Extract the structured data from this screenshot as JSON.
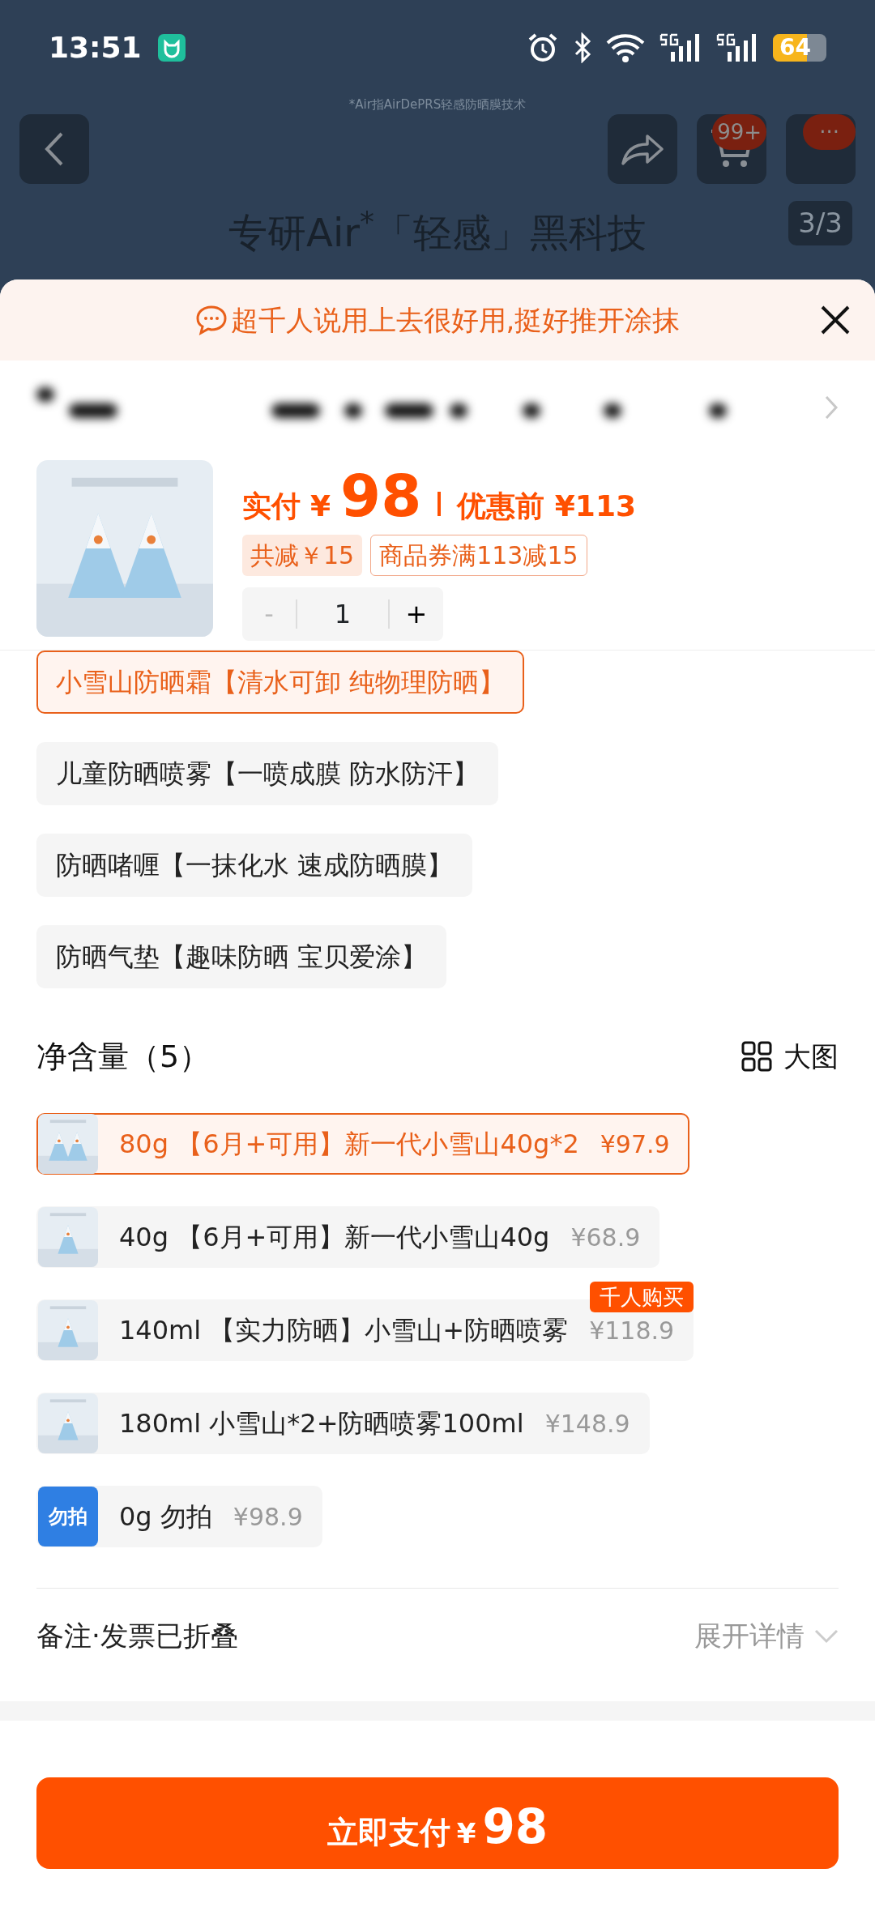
{
  "status_bar": {
    "time": "13:51",
    "battery": "64"
  },
  "backdrop": {
    "caption": "*Air指AirDePRS轻感防晒膜技术",
    "cart_badge": "99+",
    "more_badge": "···",
    "headline": "专研Air$^{*}$「轻感」黑科技",
    "page_indicator": "3/3"
  },
  "tip": {
    "text": "超千人说用上去很好用,挺好推开涂抹"
  },
  "product": {
    "price_label": "实付",
    "currency": "¥",
    "price": "98",
    "original_price": "优惠前 ¥113",
    "discount": "共减￥15",
    "coupon": "商品券满113减15",
    "minus": "-",
    "quantity": "1",
    "plus": "+"
  },
  "styles": [
    {
      "label": "小雪山防晒霜【清水可卸 纯物理防晒】",
      "selected": true
    },
    {
      "label": "儿童防晒喷雾【一喷成膜 防水防汗】",
      "selected": false
    },
    {
      "label": "防晒啫喱【一抹化水 速成防晒膜】",
      "selected": false
    },
    {
      "label": "防晒气垫【趣味防晒 宝贝爱涂】",
      "selected": false
    }
  ],
  "size_section": {
    "title": "净含量（5）",
    "view_toggle": "大图",
    "options": [
      {
        "kind": "thumb",
        "label": "80g 【6月+可用】新一代小雪山40g*2",
        "price": "¥97.9",
        "selected": true
      },
      {
        "kind": "thumb",
        "label": "40g 【6月+可用】新一代小雪山40g",
        "price": "¥68.9",
        "selected": false
      },
      {
        "kind": "thumb",
        "label": "140ml 【实力防晒】小雪山+防晒喷雾",
        "price": "¥118.9",
        "selected": false,
        "tag": "千人购买"
      },
      {
        "kind": "thumb",
        "label": "180ml 小雪山*2+防晒喷雾100ml",
        "price": "¥148.9",
        "selected": false
      },
      {
        "kind": "text-badge",
        "badge": "勿拍",
        "label": "0g 勿拍",
        "price": "¥98.9",
        "selected": false
      }
    ]
  },
  "note_row": {
    "label": "备注·发票已折叠",
    "action": "展开详情"
  },
  "pay_button": {
    "label": "立即支付",
    "currency": "¥",
    "amount": "98"
  }
}
